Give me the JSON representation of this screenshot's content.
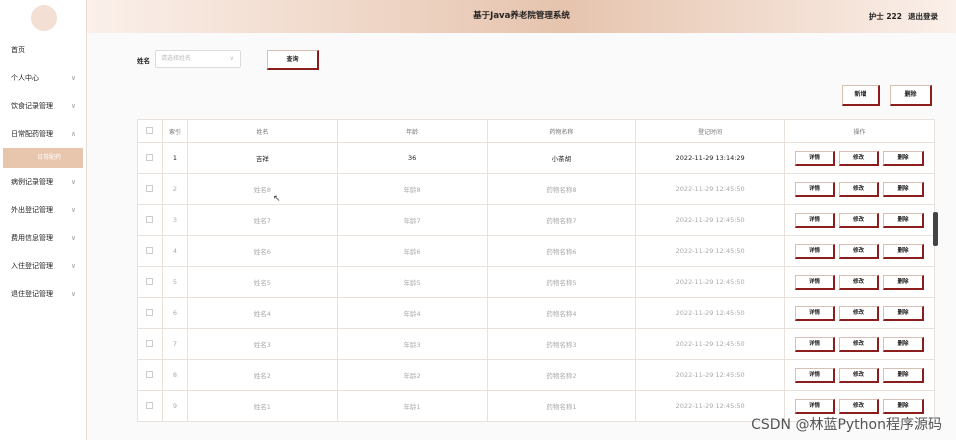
{
  "header": {
    "title": "基于Java养老院管理系统",
    "user": "护士 222",
    "logout": "退出登录"
  },
  "sidebar": {
    "items": [
      {
        "label": "首页",
        "chevron": ""
      },
      {
        "label": "个人中心",
        "chevron": "∨"
      },
      {
        "label": "饮食记录管理",
        "chevron": "∨"
      },
      {
        "label": "日常配药管理",
        "chevron": "∧"
      },
      {
        "label": "病例记录管理",
        "chevron": "∨"
      },
      {
        "label": "外出登记管理",
        "chevron": "∨"
      },
      {
        "label": "费用信息管理",
        "chevron": "∨"
      },
      {
        "label": "入住登记管理",
        "chevron": "∨"
      },
      {
        "label": "退住登记管理",
        "chevron": "∨"
      }
    ],
    "sub_active": "日常配药"
  },
  "search": {
    "label": "姓名",
    "placeholder": "请选择姓名",
    "query_button": "查询"
  },
  "toolbar": {
    "add": "新增",
    "delete": "删除"
  },
  "table": {
    "headers": [
      "",
      "索引",
      "姓名",
      "年龄",
      "药物名称",
      "登记时间",
      "操作"
    ],
    "rows": [
      {
        "idx": "1",
        "name": "吉祥",
        "age": "36",
        "drug": "小茶胡",
        "time": "2022-11-29 13:14:29"
      },
      {
        "idx": "2",
        "name": "姓名8",
        "age": "年龄8",
        "drug": "药物名称8",
        "time": "2022-11-29 12:45:50"
      },
      {
        "idx": "3",
        "name": "姓名7",
        "age": "年龄7",
        "drug": "药物名称7",
        "time": "2022-11-29 12:45:50"
      },
      {
        "idx": "4",
        "name": "姓名6",
        "age": "年龄6",
        "drug": "药物名称6",
        "time": "2022-11-29 12:45:50"
      },
      {
        "idx": "5",
        "name": "姓名5",
        "age": "年龄5",
        "drug": "药物名称5",
        "time": "2022-11-29 12:45:50"
      },
      {
        "idx": "6",
        "name": "姓名4",
        "age": "年龄4",
        "drug": "药物名称4",
        "time": "2022-11-29 12:45:50"
      },
      {
        "idx": "7",
        "name": "姓名3",
        "age": "年龄3",
        "drug": "药物名称3",
        "time": "2022-11-29 12:45:50"
      },
      {
        "idx": "8",
        "name": "姓名2",
        "age": "年龄2",
        "drug": "药物名称2",
        "time": "2022-11-29 12:45:50"
      },
      {
        "idx": "9",
        "name": "姓名1",
        "age": "年龄1",
        "drug": "药物名称1",
        "time": "2022-11-29 12:45:50"
      }
    ],
    "actions": [
      "详情",
      "修改",
      "删除"
    ]
  },
  "watermark": "CSDN @林蓝Python程序源码",
  "colors": {
    "accent": "#8b1d1d",
    "header": "#e6c4ae",
    "active_sub": "#e8c6ae"
  }
}
